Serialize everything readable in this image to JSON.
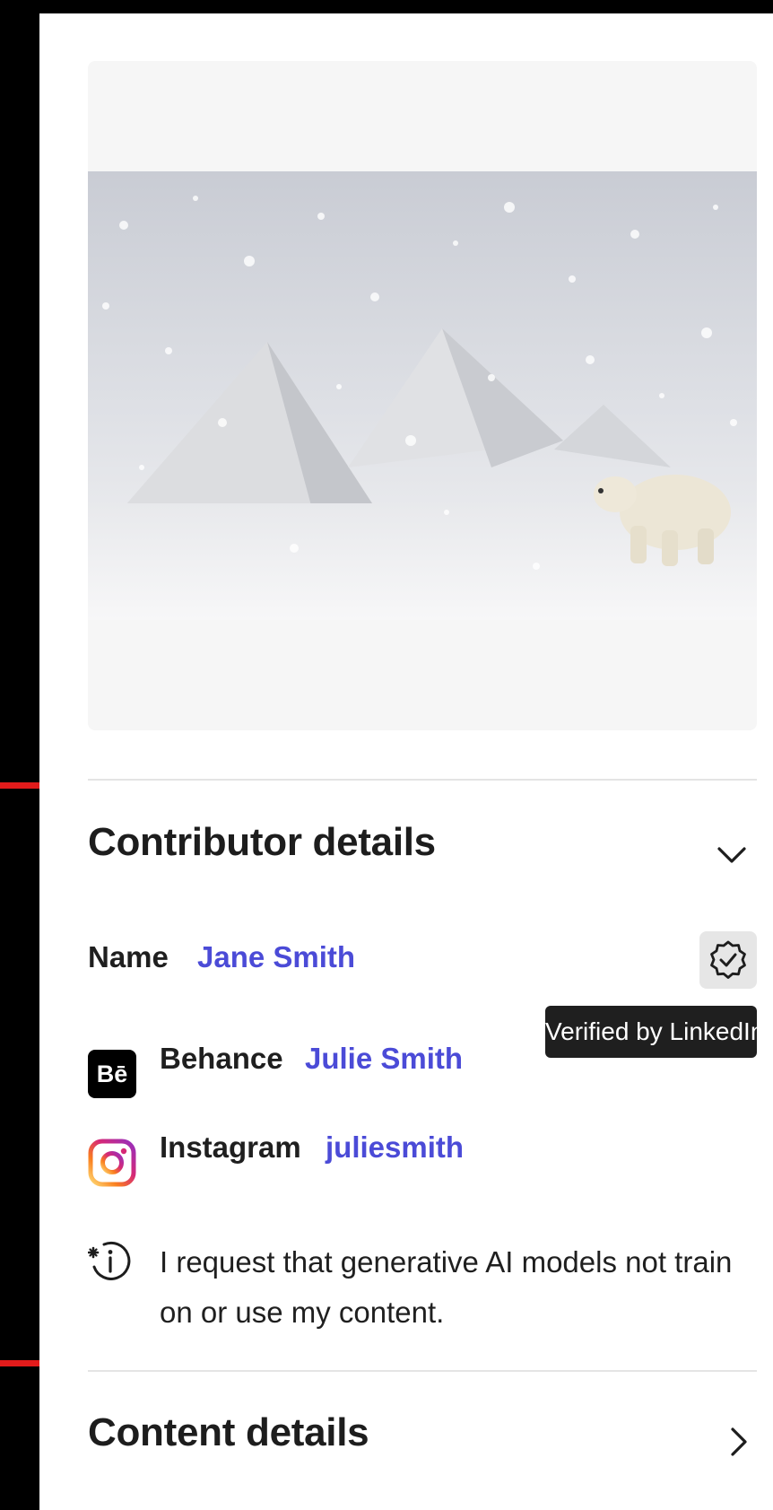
{
  "contributor": {
    "title": "Contributor details",
    "name_label": "Name",
    "name_value": "Jane Smith",
    "verify_tooltip": "Verified by LinkedIn",
    "behance_label": "Behance",
    "behance_value": "Julie Smith",
    "behance_icon_text": "Bē",
    "instagram_label": "Instagram",
    "instagram_value": "juliesmith",
    "ai_notice": "I request that generative AI models not train on or use my content."
  },
  "content": {
    "title": "Content details"
  },
  "icons": {
    "collapse": "chevron-down-icon",
    "expand": "chevron-right-icon",
    "verified": "verified-badge-icon",
    "behance": "behance-icon",
    "instagram": "instagram-icon",
    "ai": "ai-training-icon"
  },
  "colors": {
    "link": "#4b4bd7",
    "tooltip_bg": "#1f1f1f",
    "accent_marker": "#e21b1b"
  }
}
